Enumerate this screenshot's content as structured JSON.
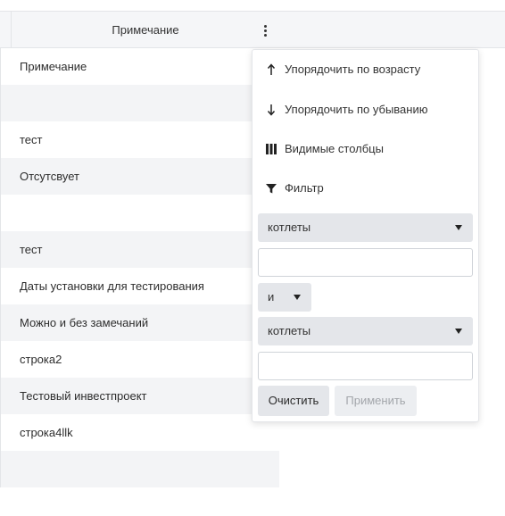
{
  "header": {
    "column_title": "Примечание"
  },
  "rows": [
    "Примечание",
    "",
    "тест",
    "Отсутсвует",
    "",
    "тест",
    "Даты установки для тестирования",
    "Можно и без замечаний",
    "строка2",
    "Тестовый инвестпроект",
    "строка4llk",
    ""
  ],
  "menu": {
    "sort_asc": "Упорядочить по возрасту",
    "sort_desc": "Упорядочить по убыванию",
    "visible_columns": "Видимые столбцы",
    "filter": "Фильтр"
  },
  "filter": {
    "condition1": "котлеты",
    "value1": "",
    "operator": "и",
    "condition2": "котлеты",
    "value2": "",
    "clear_label": "Очистить",
    "apply_label": "Применить"
  },
  "icons": {
    "column_menu": "vertical-dots-icon",
    "sort_asc": "arrow-up-icon",
    "sort_desc": "arrow-down-icon",
    "columns": "columns-icon",
    "filter": "funnel-icon",
    "dropdown": "caret-down-icon"
  }
}
